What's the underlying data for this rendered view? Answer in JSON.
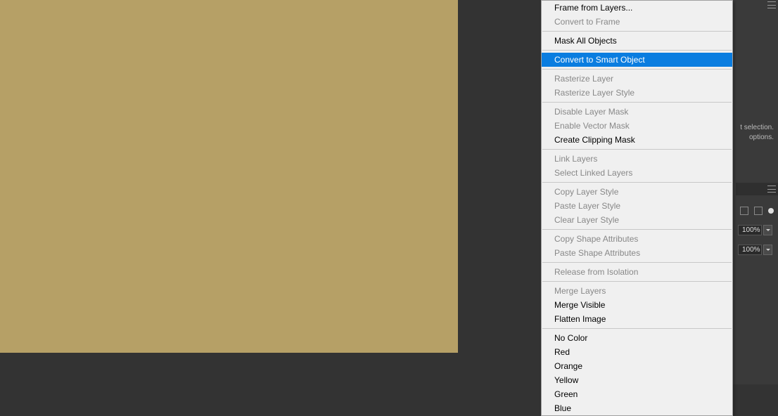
{
  "menu": {
    "items": [
      {
        "label": "Frame from Layers...",
        "disabled": false
      },
      {
        "label": "Convert to Frame",
        "disabled": true
      },
      {
        "separator": true
      },
      {
        "label": "Mask All Objects",
        "disabled": false
      },
      {
        "separator": true
      },
      {
        "label": "Convert to Smart Object",
        "disabled": false,
        "highlighted": true
      },
      {
        "separator": true
      },
      {
        "label": "Rasterize Layer",
        "disabled": true
      },
      {
        "label": "Rasterize Layer Style",
        "disabled": true
      },
      {
        "separator": true
      },
      {
        "label": "Disable Layer Mask",
        "disabled": true
      },
      {
        "label": "Enable Vector Mask",
        "disabled": true
      },
      {
        "label": "Create Clipping Mask",
        "disabled": false
      },
      {
        "separator": true
      },
      {
        "label": "Link Layers",
        "disabled": true
      },
      {
        "label": "Select Linked Layers",
        "disabled": true
      },
      {
        "separator": true
      },
      {
        "label": "Copy Layer Style",
        "disabled": true
      },
      {
        "label": "Paste Layer Style",
        "disabled": true
      },
      {
        "label": "Clear Layer Style",
        "disabled": true
      },
      {
        "separator": true
      },
      {
        "label": "Copy Shape Attributes",
        "disabled": true
      },
      {
        "label": "Paste Shape Attributes",
        "disabled": true
      },
      {
        "separator": true
      },
      {
        "label": "Release from Isolation",
        "disabled": true
      },
      {
        "separator": true
      },
      {
        "label": "Merge Layers",
        "disabled": true
      },
      {
        "label": "Merge Visible",
        "disabled": false
      },
      {
        "label": "Flatten Image",
        "disabled": false
      },
      {
        "separator": true
      },
      {
        "label": "No Color",
        "disabled": false
      },
      {
        "label": "Red",
        "disabled": false
      },
      {
        "label": "Orange",
        "disabled": false
      },
      {
        "label": "Yellow",
        "disabled": false
      },
      {
        "label": "Green",
        "disabled": false
      },
      {
        "label": "Blue",
        "disabled": false
      }
    ]
  },
  "rightPanel": {
    "hint1": "t selection.",
    "hint2": "options.",
    "opacity": "100%",
    "fill": "100%"
  }
}
